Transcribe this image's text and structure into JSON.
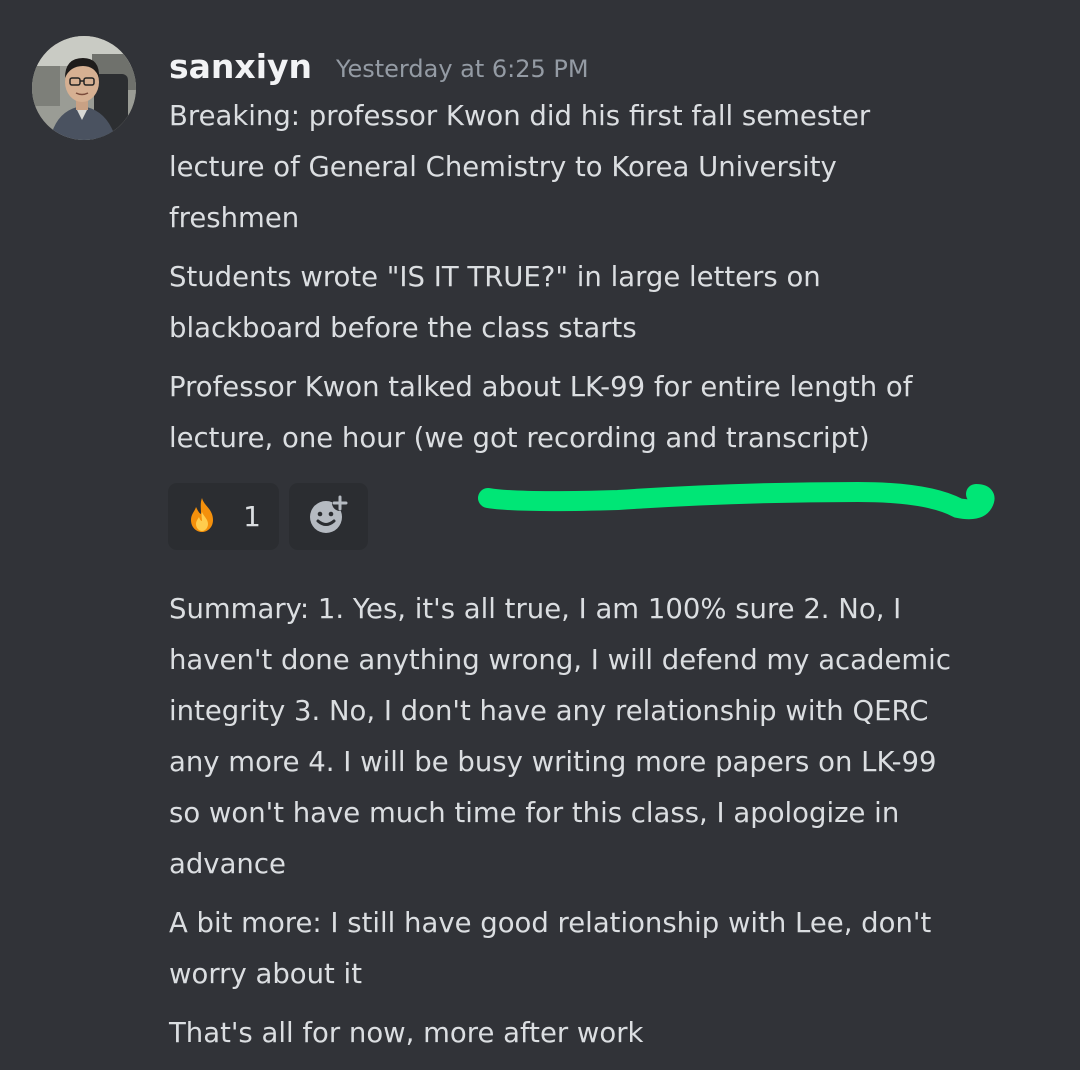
{
  "message": {
    "username": "sanxiyn",
    "timestamp": "Yesterday at 6:25 PM",
    "lines_first": [
      "Breaking: professor Kwon did his first fall semester",
      "lecture of General Chemistry to Korea University",
      "freshmen",
      "Students wrote \"IS IT TRUE?\" in large letters on",
      "blackboard before the class starts",
      "Professor Kwon talked about LK-99 for entire length of",
      "lecture, one hour (we got recording and transcript)"
    ],
    "reactions": [
      {
        "emoji": "fire-icon",
        "count": "1"
      },
      {
        "emoji": "add-reaction-icon"
      }
    ],
    "lines_second": [
      "Summary: 1. Yes, it's all true, I am 100% sure 2. No, I",
      "haven't done anything wrong, I will defend my academic",
      "integrity 3. No, I don't have any relationship with QERC",
      "any more 4. I will be busy writing more papers on LK-99",
      "so won't have much time for this class, I apologize in",
      "advance",
      "A bit more: I still have good relationship with Lee, don't",
      "worry about it",
      "That's all for now, more after work"
    ]
  },
  "colors": {
    "background": "#313338",
    "username": "#f2f3f5",
    "timestamp": "#949ba4",
    "text": "#dbdee1",
    "reaction_bg": "#2b2d31",
    "highlight": "#00e676"
  }
}
